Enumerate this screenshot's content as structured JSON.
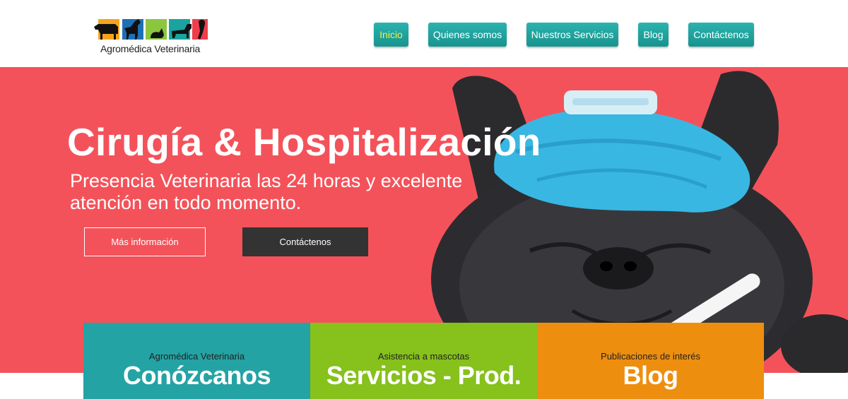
{
  "brand": {
    "name": "Agromédica Veterinaria",
    "tile_colors": [
      "#f7a41c",
      "#1f6fb5",
      "#8cc63f",
      "#1aa39f",
      "#ee3e4b"
    ]
  },
  "nav": {
    "items": [
      {
        "label": "Inicio",
        "active": true
      },
      {
        "label": "Quienes somos",
        "active": false
      },
      {
        "label": "Nuestros Servicios",
        "active": false
      },
      {
        "label": "Blog",
        "active": false
      },
      {
        "label": "Contáctenos",
        "active": false
      }
    ]
  },
  "hero": {
    "title": "Cirugía & Hospitalización",
    "subtitle": "Presencia Veterinaria las 24 horas y excelente atención en todo momento.",
    "more_button": "Más información",
    "contact_button": "Contáctenos",
    "background_color": "#f4525a"
  },
  "tiles": [
    {
      "small": "Agromédica Veterinaria",
      "big": "Conózcanos",
      "color": "#24a3a4"
    },
    {
      "small": "Asistencia a mascotas",
      "big": "Servicios - Prod.",
      "color": "#86c11c"
    },
    {
      "small": "Publicaciones de interés",
      "big": "Blog",
      "color": "#ee8e0e"
    }
  ]
}
